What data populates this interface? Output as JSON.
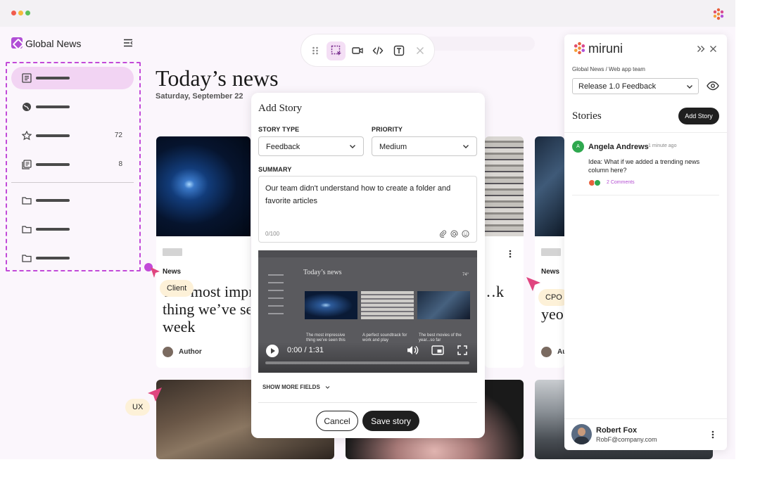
{
  "sidebar": {
    "title": "Global News",
    "items": [
      {
        "icon": "article-icon",
        "count": ""
      },
      {
        "icon": "globe-icon",
        "count": ""
      },
      {
        "icon": "star-icon",
        "count": "72"
      },
      {
        "icon": "library-icon",
        "count": "8"
      },
      {
        "icon": "folder-icon",
        "count": ""
      },
      {
        "icon": "folder-icon",
        "count": ""
      },
      {
        "icon": "folder-icon",
        "count": ""
      }
    ]
  },
  "header": {
    "title": "Today’s news",
    "date": "Saturday, September 22"
  },
  "cards": [
    {
      "tag": "News",
      "headline_l1": "The most impressive",
      "headline_l2": "thing we’ve seen this",
      "headline_l3": "week",
      "author": "Author"
    },
    {
      "tag": "News",
      "headline_l1": "…k",
      "author": ""
    },
    {
      "tag": "News",
      "headline_l1": "…",
      "headline_l2": "yeo",
      "author": "Au"
    }
  ],
  "cursors": {
    "client": "Client",
    "cpo": "CPO",
    "ux": "UX"
  },
  "modal": {
    "title": "Add Story",
    "story_type_label": "STORY TYPE",
    "story_type_value": "Feedback",
    "priority_label": "PRIORITY",
    "priority_value": "Medium",
    "summary_label": "SUMMARY",
    "summary_value": "Our team didn't understand how to create a folder and favorite articles",
    "counter": "0/100",
    "video": {
      "time": "0:00 / 1:31",
      "progress": 0.0,
      "thumb_title": "Today’s news",
      "thumb_temp": "74°",
      "thumb_captions": [
        "The most impressive thing we’ve seen this",
        "A perfect soundtrack for work and play",
        "The best movies of the year...so far"
      ]
    },
    "show_more": "SHOW MORE FIELDS",
    "cancel": "Cancel",
    "save": "Save story"
  },
  "panel": {
    "brand": "miruni",
    "path": "Global News / Web app team",
    "release": "Release 1.0 Feedback",
    "stories_title": "Stories",
    "add_story": "Add Story",
    "story": {
      "avatar": "A",
      "name": "Angela Andrews",
      "time": "1 minute ago",
      "text": "Idea: What if we added a trending news column here?",
      "comments": "2 Comments"
    },
    "user": {
      "name": "Robert Fox",
      "email": "RobF@company.com"
    }
  },
  "colors": {
    "accent": "#c24ad8",
    "highlight": "#f2d4f3",
    "dark": "#1f1f1f",
    "cursor_pink": "#e0457f",
    "story_green": "#2fa84f"
  }
}
